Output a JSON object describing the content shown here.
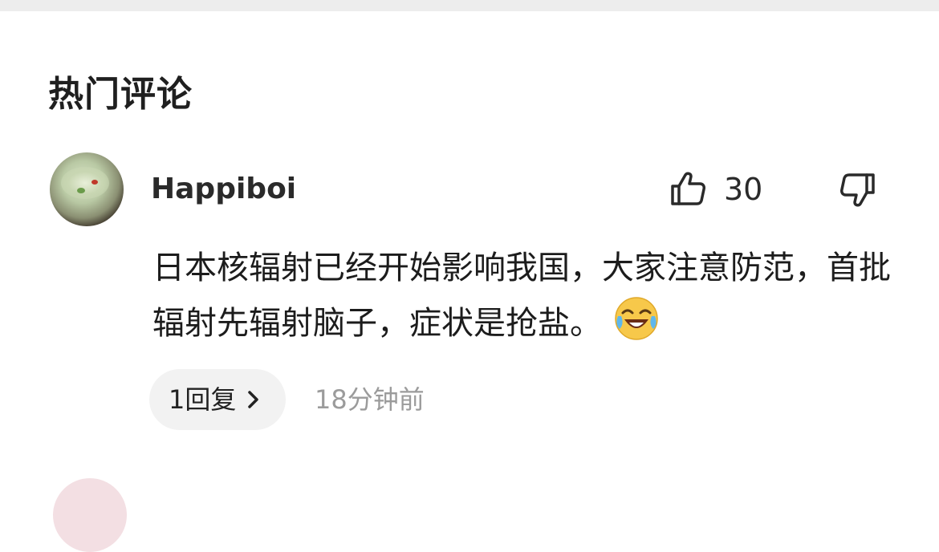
{
  "section": {
    "title": "热门评论"
  },
  "comment": {
    "username": "Happiboi",
    "avatar_icon": "food-bowl-avatar",
    "like_icon": "thumbs-up-icon",
    "like_count": "30",
    "dislike_icon": "thumbs-down-icon",
    "text": "日本核辐射已经开始影响我国，大家注意防范，首批辐射先辐射脑子，症状是抢盐。",
    "emoji_icon": "laughing-crying-emoji",
    "reply_label": "1回复",
    "reply_chevron_icon": "chevron-right-icon",
    "timestamp": "18分钟前"
  },
  "colors": {
    "text_primary": "#222222",
    "text_secondary": "#9b9b9b",
    "reply_bg": "#f2f2f2",
    "top_bar": "#ededed"
  }
}
